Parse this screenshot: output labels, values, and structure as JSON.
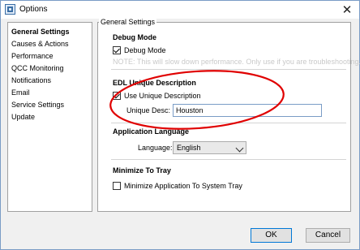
{
  "window": {
    "title": "Options",
    "close_glyph": "✕",
    "icons": {
      "app": "options-app-icon",
      "close": "close-icon"
    }
  },
  "nav": {
    "items": [
      "General Settings",
      "Causes & Actions",
      "Performance",
      "QCC Monitoring",
      "Notifications",
      "Email",
      "Service Settings",
      "Update"
    ],
    "selected": "General Settings"
  },
  "panel": {
    "header": "General Settings",
    "debug": {
      "title": "Debug Mode",
      "checkbox_label": "Debug Mode",
      "checked": true,
      "note": "NOTE: This will slow down performance. Only use if you are troubleshooting."
    },
    "edl": {
      "title": "EDL Unique Description",
      "checkbox_label": "Use Unique Description",
      "checked": true,
      "field_label": "Unique Desc:",
      "field_value": "Houston"
    },
    "language": {
      "title": "Application Language",
      "field_label": "Language:",
      "selected": "English"
    },
    "tray": {
      "title": "Minimize To Tray",
      "checkbox_label": "Minimize Application To System Tray",
      "checked": false
    }
  },
  "buttons": {
    "ok": "OK",
    "cancel": "Cancel"
  },
  "annotation": {
    "shape": "ellipse",
    "color": "#e00000"
  }
}
